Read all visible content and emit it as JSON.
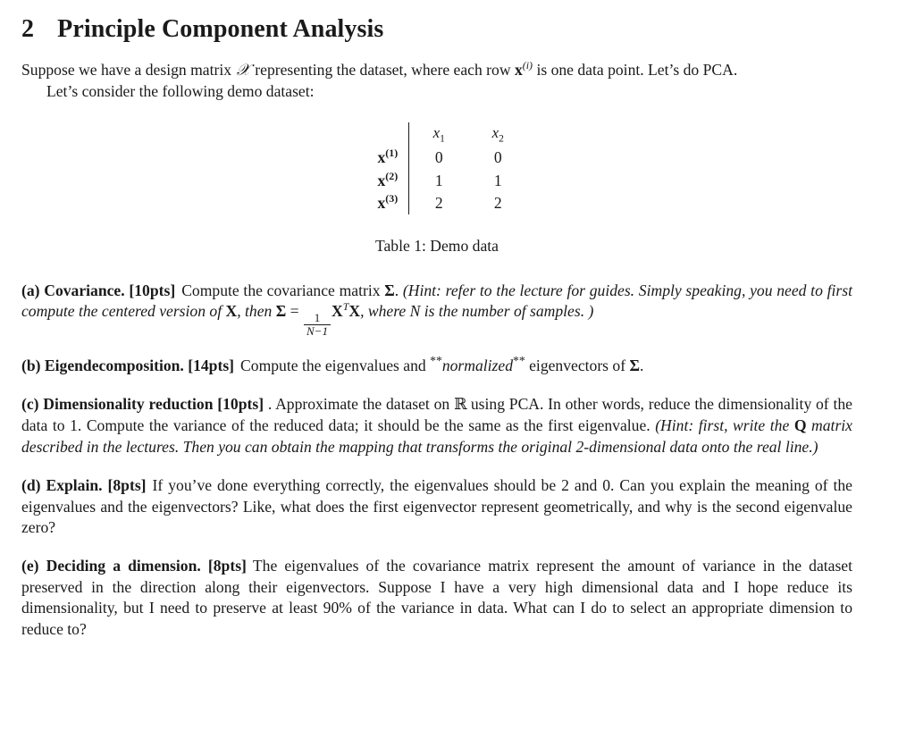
{
  "section": {
    "number": "2",
    "title": "Principle Component Analysis"
  },
  "intro": {
    "line_a": "Suppose we have a design matrix",
    "design_matrix_symbol": "𝒳",
    "line_b": "representing the dataset, where each row",
    "row_symbol": "x",
    "row_superscript": "(i)",
    "line_c": "is one data point. Let’s do PCA.",
    "line_d": "Let’s consider the following demo dataset:"
  },
  "table": {
    "headers": [
      "x₁",
      "x₂"
    ],
    "header_bases": [
      "x",
      "x"
    ],
    "header_subs": [
      "1",
      "2"
    ],
    "rows": [
      {
        "label_base": "x",
        "label_sup": "(1)",
        "values": [
          "0",
          "0"
        ]
      },
      {
        "label_base": "x",
        "label_sup": "(2)",
        "values": [
          "1",
          "1"
        ]
      },
      {
        "label_base": "x",
        "label_sup": "(3)",
        "values": [
          "2",
          "2"
        ]
      }
    ],
    "caption": "Table 1: Demo data"
  },
  "parts": {
    "a": {
      "label": "(a) Covariance.",
      "points": "[10pts]",
      "text_1": "Compute the covariance matrix",
      "sigma": "Σ",
      "text_2": ".",
      "hint_1": "(Hint: refer to the lecture for guides. Simply speaking, you need to first compute the centered version of",
      "bold_X": "X",
      "hint_2": ", then",
      "sigma_2": "Σ",
      "equals": "=",
      "frac_num": "1",
      "frac_den": "N−1",
      "matrix_expr_base": "X",
      "matrix_expr_sup": "T",
      "matrix_expr_base2": "X",
      "hint_3": ", where",
      "N": "N",
      "hint_4": "is the number of samples. )"
    },
    "b": {
      "label": "(b) Eigendecomposition.",
      "points": "[14pts]",
      "text_1": "Compute the eigenvalues and",
      "stars_open": "**",
      "emphasis": "normalized",
      "stars_close": "**",
      "text_2": "eigenvectors of",
      "sigma": "Σ",
      "text_3": "."
    },
    "c": {
      "label": "(c) Dimensionality reduction",
      "points": "[10pts]",
      "separator": ".",
      "text_1": "Approximate the dataset on",
      "reals": "ℝ",
      "text_2": "using PCA. In other words, reduce the dimensionality of the data to 1. Compute the variance of the reduced data; it should be the same as the first eigenvalue.",
      "hint_1": "(Hint: first, write the",
      "bold_Q": "Q",
      "hint_2": "matrix described in the lectures. Then you can obtain the mapping that transforms the original 2-dimensional data onto the real line.)"
    },
    "d": {
      "label": "(d) Explain.",
      "points": "[8pts]",
      "text": "If you’ve done everything correctly, the eigenvalues should be 2 and 0. Can you explain the meaning of the eigenvalues and the eigenvectors? Like, what does the first eigenvector represent geometrically, and why is the second eigenvalue zero?"
    },
    "e": {
      "label": "(e) Deciding a dimension.",
      "points": "[8pts]",
      "text": "The eigenvalues of the covariance matrix represent the amount of variance in the dataset preserved in the direction along their eigenvectors. Suppose I have a very high dimensional data and I hope reduce its dimensionality, but I need to preserve at least 90% of the variance in data. What can I do to select an appropriate dimension to reduce to?"
    }
  }
}
